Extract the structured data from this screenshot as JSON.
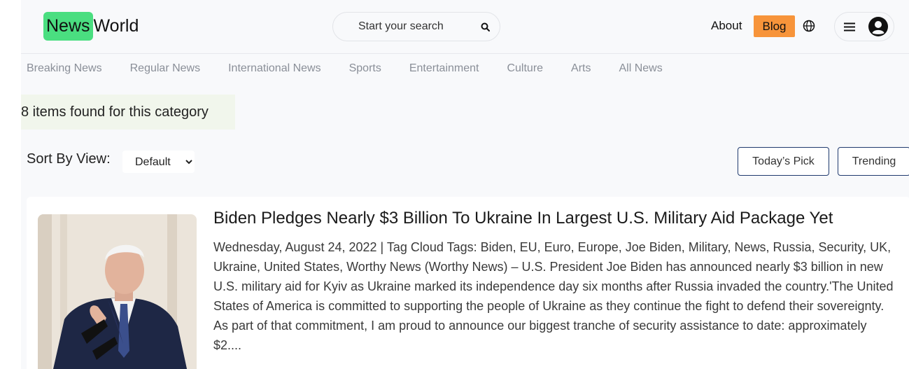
{
  "header": {
    "logo_part1": "News",
    "logo_part2": "World",
    "search_placeholder": "Start your search",
    "about_label": "About",
    "blog_label": "Blog"
  },
  "categories": [
    "Breaking News",
    "Regular News",
    "International News",
    "Sports",
    "Entertainment",
    "Culture",
    "Arts",
    "All News"
  ],
  "result_text": "8 items found for this category",
  "sort": {
    "label": "Sort By View:",
    "selected": "Default"
  },
  "buttons": {
    "todays_pick": "Today’s Pick",
    "trending": "Trending"
  },
  "article": {
    "title": "Biden Pledges Nearly $3 Billion To Ukraine In Largest U.S. Military Aid Package Yet",
    "excerpt": "Wednesday, August 24, 2022 | Tag Cloud Tags: Biden, EU, Euro, Europe, Joe Biden, Military, News, Russia, Security, UK, Ukraine, United States, Worthy News (Worthy News) – U.S. President Joe Biden has announced nearly $3 billion in new U.S. military aid for Kyiv as Ukraine marked its independence day six months after Russia invaded the country.'The United States of America is committed to supporting the people of Ukraine as they continue the fight to defend their sovereignty. As part of that commitment, I am proud to announce our biggest tranche of security assistance to date: approximately $2...."
  },
  "icons": {
    "search": "search-icon",
    "globe": "globe-icon",
    "menu": "menu-icon",
    "avatar": "user-avatar-icon"
  },
  "colors": {
    "logo_accent": "#4ade80",
    "blog_accent": "#f7943a",
    "outline_button": "#1f3a6e",
    "result_bg": "#f1f6ec"
  }
}
